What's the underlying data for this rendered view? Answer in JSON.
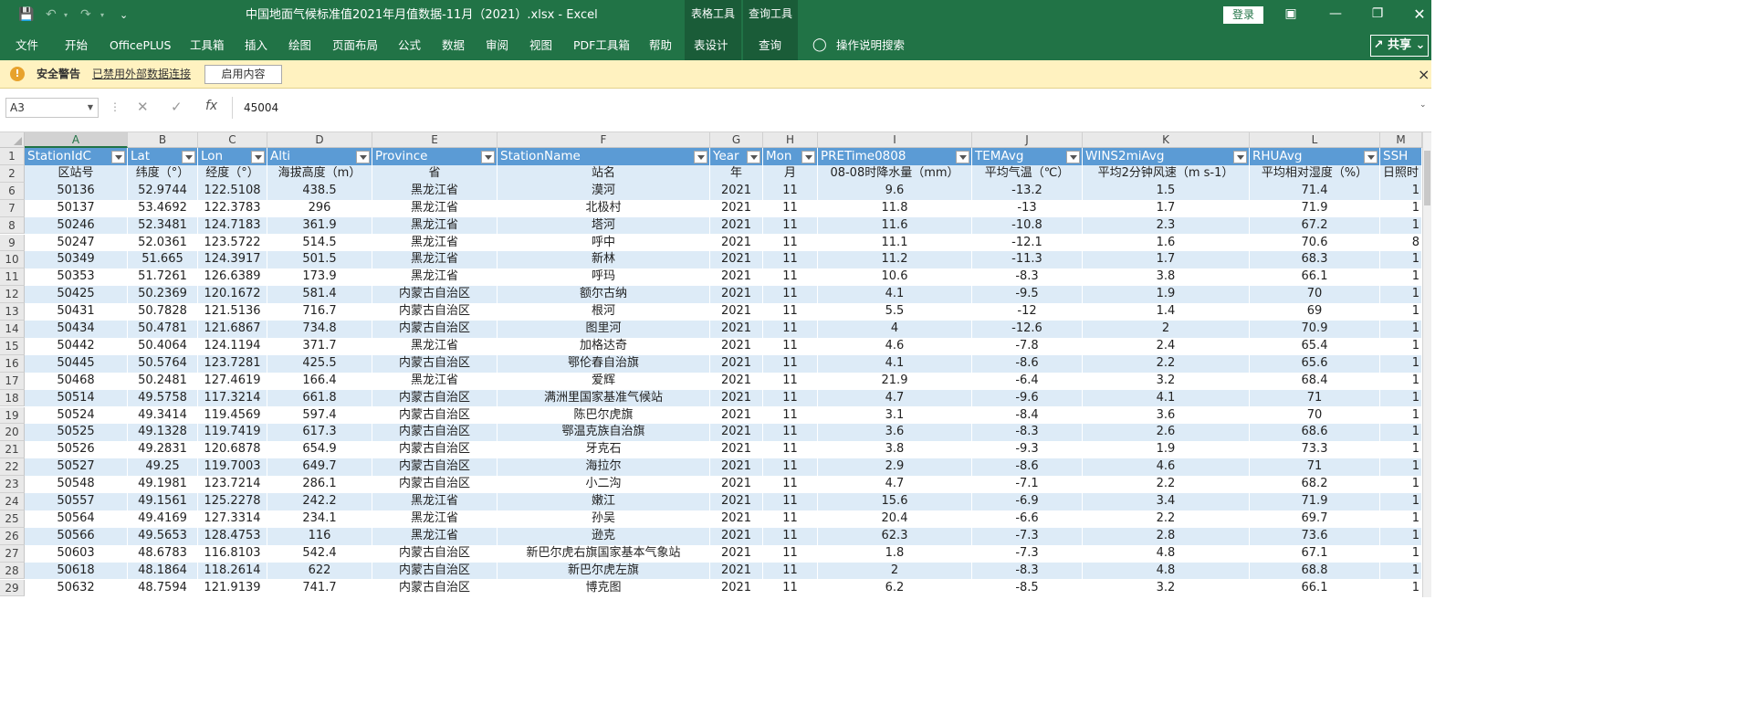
{
  "app": {
    "window_title": "中国地面气候标准值2021年月值数据-11月（2021）.xlsx  -  Excel",
    "context_tabs": [
      "表格工具",
      "查询工具"
    ],
    "login_label": "登录",
    "share_label": "共享",
    "accent_color": "#217346"
  },
  "ribbon": {
    "tabs": [
      "文件",
      "开始",
      "OfficePLUS",
      "工具箱",
      "插入",
      "绘图",
      "页面布局",
      "公式",
      "数据",
      "审阅",
      "视图",
      "PDF工具箱",
      "帮助",
      "表设计",
      "查询"
    ],
    "tell_me": "操作说明搜索"
  },
  "security_bar": {
    "title": "安全警告",
    "message": "已禁用外部数据连接",
    "enable_button": "启用内容",
    "close": "×"
  },
  "formula_bar": {
    "name_box": "A3",
    "fx": "fx",
    "value": "45004"
  },
  "sheet": {
    "column_letters": [
      "A",
      "B",
      "C",
      "D",
      "E",
      "F",
      "G",
      "H",
      "I",
      "J",
      "K",
      "L",
      "M"
    ],
    "header_row": [
      "StationIdC",
      "Lat",
      "Lon",
      "Alti",
      "Province",
      "StationName",
      "Year",
      "Mon",
      "PRETime0808",
      "TEMAvg",
      "WINS2miAvg",
      "RHUAvg",
      "SSH"
    ],
    "sub_header_row": [
      "区站号",
      "纬度（°）",
      "经度（°）",
      "海拔高度（m）",
      "省",
      "站名",
      "年",
      "月",
      "08-08时降水量（mm）",
      "平均气温（℃）",
      "平均2分钟风速（m s-1）",
      "平均相对湿度（%）",
      "日照时"
    ],
    "rows": [
      {
        "n": "6",
        "cells": [
          "50136",
          "52.9744",
          "122.5108",
          "438.5",
          "黑龙江省",
          "漠河",
          "2021",
          "11",
          "9.6",
          "-13.2",
          "1.5",
          "71.4",
          "1"
        ]
      },
      {
        "n": "7",
        "cells": [
          "50137",
          "53.4692",
          "122.3783",
          "296",
          "黑龙江省",
          "北极村",
          "2021",
          "11",
          "11.8",
          "-13",
          "1.7",
          "71.9",
          "1"
        ]
      },
      {
        "n": "8",
        "cells": [
          "50246",
          "52.3481",
          "124.7183",
          "361.9",
          "黑龙江省",
          "塔河",
          "2021",
          "11",
          "11.6",
          "-10.8",
          "2.3",
          "67.2",
          "1"
        ]
      },
      {
        "n": "9",
        "cells": [
          "50247",
          "52.0361",
          "123.5722",
          "514.5",
          "黑龙江省",
          "呼中",
          "2021",
          "11",
          "11.1",
          "-12.1",
          "1.6",
          "70.6",
          "8"
        ]
      },
      {
        "n": "10",
        "cells": [
          "50349",
          "51.665",
          "124.3917",
          "501.5",
          "黑龙江省",
          "新林",
          "2021",
          "11",
          "11.2",
          "-11.3",
          "1.7",
          "68.3",
          "1"
        ]
      },
      {
        "n": "11",
        "cells": [
          "50353",
          "51.7261",
          "126.6389",
          "173.9",
          "黑龙江省",
          "呼玛",
          "2021",
          "11",
          "10.6",
          "-8.3",
          "3.8",
          "66.1",
          "1"
        ]
      },
      {
        "n": "12",
        "cells": [
          "50425",
          "50.2369",
          "120.1672",
          "581.4",
          "内蒙古自治区",
          "额尔古纳",
          "2021",
          "11",
          "4.1",
          "-9.5",
          "1.9",
          "70",
          "1"
        ]
      },
      {
        "n": "13",
        "cells": [
          "50431",
          "50.7828",
          "121.5136",
          "716.7",
          "内蒙古自治区",
          "根河",
          "2021",
          "11",
          "5.5",
          "-12",
          "1.4",
          "69",
          "1"
        ]
      },
      {
        "n": "14",
        "cells": [
          "50434",
          "50.4781",
          "121.6867",
          "734.8",
          "内蒙古自治区",
          "图里河",
          "2021",
          "11",
          "4",
          "-12.6",
          "2",
          "70.9",
          "1"
        ]
      },
      {
        "n": "15",
        "cells": [
          "50442",
          "50.4064",
          "124.1194",
          "371.7",
          "黑龙江省",
          "加格达奇",
          "2021",
          "11",
          "4.6",
          "-7.8",
          "2.4",
          "65.4",
          "1"
        ]
      },
      {
        "n": "16",
        "cells": [
          "50445",
          "50.5764",
          "123.7281",
          "425.5",
          "内蒙古自治区",
          "鄂伦春自治旗",
          "2021",
          "11",
          "4.1",
          "-8.6",
          "2.2",
          "65.6",
          "1"
        ]
      },
      {
        "n": "17",
        "cells": [
          "50468",
          "50.2481",
          "127.4619",
          "166.4",
          "黑龙江省",
          "爱辉",
          "2021",
          "11",
          "21.9",
          "-6.4",
          "3.2",
          "68.4",
          "1"
        ]
      },
      {
        "n": "18",
        "cells": [
          "50514",
          "49.5758",
          "117.3214",
          "661.8",
          "内蒙古自治区",
          "满洲里国家基准气候站",
          "2021",
          "11",
          "4.7",
          "-9.6",
          "4.1",
          "71",
          "1"
        ]
      },
      {
        "n": "19",
        "cells": [
          "50524",
          "49.3414",
          "119.4569",
          "597.4",
          "内蒙古自治区",
          "陈巴尔虎旗",
          "2021",
          "11",
          "3.1",
          "-8.4",
          "3.6",
          "70",
          "1"
        ]
      },
      {
        "n": "20",
        "cells": [
          "50525",
          "49.1328",
          "119.7419",
          "617.3",
          "内蒙古自治区",
          "鄂温克族自治旗",
          "2021",
          "11",
          "3.6",
          "-8.3",
          "2.6",
          "68.6",
          "1"
        ]
      },
      {
        "n": "21",
        "cells": [
          "50526",
          "49.2831",
          "120.6878",
          "654.9",
          "内蒙古自治区",
          "牙克石",
          "2021",
          "11",
          "3.8",
          "-9.3",
          "1.9",
          "73.3",
          "1"
        ]
      },
      {
        "n": "22",
        "cells": [
          "50527",
          "49.25",
          "119.7003",
          "649.7",
          "内蒙古自治区",
          "海拉尔",
          "2021",
          "11",
          "2.9",
          "-8.6",
          "4.6",
          "71",
          "1"
        ]
      },
      {
        "n": "23",
        "cells": [
          "50548",
          "49.1981",
          "123.7214",
          "286.1",
          "内蒙古自治区",
          "小二沟",
          "2021",
          "11",
          "4.7",
          "-7.1",
          "2.2",
          "68.2",
          "1"
        ]
      },
      {
        "n": "24",
        "cells": [
          "50557",
          "49.1561",
          "125.2278",
          "242.2",
          "黑龙江省",
          "嫩江",
          "2021",
          "11",
          "15.6",
          "-6.9",
          "3.4",
          "71.9",
          "1"
        ]
      },
      {
        "n": "25",
        "cells": [
          "50564",
          "49.4169",
          "127.3314",
          "234.1",
          "黑龙江省",
          "孙吴",
          "2021",
          "11",
          "20.4",
          "-6.6",
          "2.2",
          "69.7",
          "1"
        ]
      },
      {
        "n": "26",
        "cells": [
          "50566",
          "49.5653",
          "128.4753",
          "116",
          "黑龙江省",
          "逊克",
          "2021",
          "11",
          "62.3",
          "-7.3",
          "2.8",
          "73.6",
          "1"
        ]
      },
      {
        "n": "27",
        "cells": [
          "50603",
          "48.6783",
          "116.8103",
          "542.4",
          "内蒙古自治区",
          "新巴尔虎右旗国家基本气象站",
          "2021",
          "11",
          "1.8",
          "-7.3",
          "4.8",
          "67.1",
          "1"
        ]
      },
      {
        "n": "28",
        "cells": [
          "50618",
          "48.1864",
          "118.2614",
          "622",
          "内蒙古自治区",
          "新巴尔虎左旗",
          "2021",
          "11",
          "2",
          "-8.3",
          "4.8",
          "68.8",
          "1"
        ]
      },
      {
        "n": "29",
        "cells": [
          "50632",
          "48.7594",
          "121.9139",
          "741.7",
          "内蒙古自治区",
          "博克图",
          "2021",
          "11",
          "6.2",
          "-8.5",
          "3.2",
          "66.1",
          "1"
        ]
      }
    ]
  }
}
